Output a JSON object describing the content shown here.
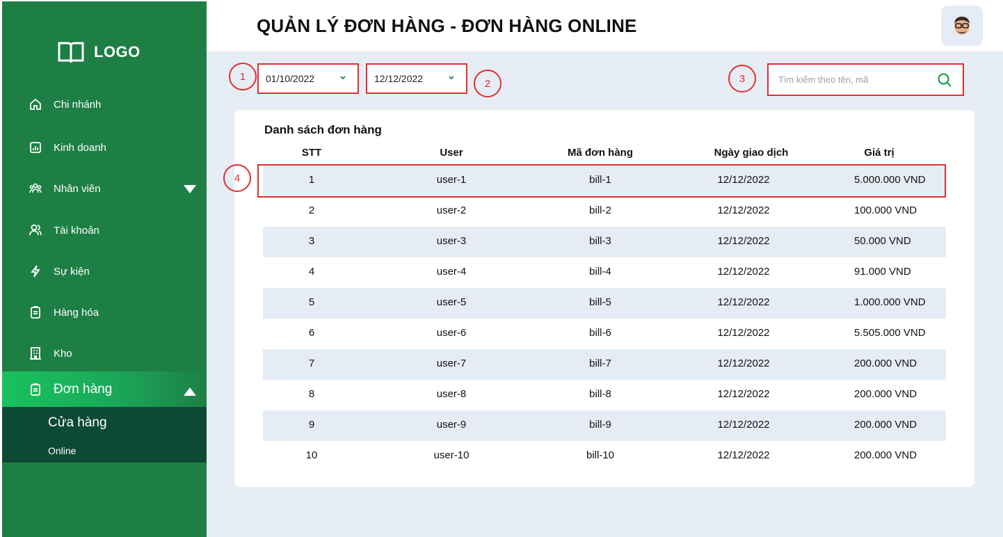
{
  "sidebar": {
    "logo_text": "LOGO",
    "items": [
      {
        "label": "Chi nhánh",
        "icon": "home-icon"
      },
      {
        "label": "Kinh doanh",
        "icon": "chart-icon"
      },
      {
        "label": "Nhân viên",
        "icon": "users-icon"
      },
      {
        "label": "Tài khoản",
        "icon": "account-icon"
      },
      {
        "label": "Sự kiện",
        "icon": "lightning-icon"
      },
      {
        "label": "Hàng hóa",
        "icon": "clipboard-icon"
      },
      {
        "label": "Kho",
        "icon": "building-icon"
      },
      {
        "label": "Đơn hàng",
        "icon": "order-icon"
      }
    ],
    "submenu": [
      "Cửa hàng",
      "Online"
    ]
  },
  "header": {
    "title": "QUẢN LÝ ĐƠN HÀNG - ĐƠN HÀNG ONLINE"
  },
  "filters": {
    "from_date": "01/10/2022",
    "to_date": "12/12/2022",
    "search_placeholder": "Tìm kiếm theo tên, mã"
  },
  "annotations": [
    "1",
    "2",
    "3",
    "4"
  ],
  "orders": {
    "title": "Danh sách đơn hàng",
    "columns": [
      "STT",
      "User",
      "Mã đơn hàng",
      "Ngày giao dịch",
      "Giá trị"
    ],
    "rows": [
      [
        "1",
        "user-1",
        "bill-1",
        "12/12/2022",
        "5.000.000 VND"
      ],
      [
        "2",
        "user-2",
        "bill-2",
        "12/12/2022",
        "100.000 VND"
      ],
      [
        "3",
        "user-3",
        "bill-3",
        "12/12/2022",
        "50.000 VND"
      ],
      [
        "4",
        "user-4",
        "bill-4",
        "12/12/2022",
        "91.000 VND"
      ],
      [
        "5",
        "user-5",
        "bill-5",
        "12/12/2022",
        "1.000.000 VND"
      ],
      [
        "6",
        "user-6",
        "bill-6",
        "12/12/2022",
        "5.505.000 VND"
      ],
      [
        "7",
        "user-7",
        "bill-7",
        "12/12/2022",
        "200.000 VND"
      ],
      [
        "8",
        "user-8",
        "bill-8",
        "12/12/2022",
        "200.000 VND"
      ],
      [
        "9",
        "user-9",
        "bill-9",
        "12/12/2022",
        "200.000 VND"
      ],
      [
        "10",
        "user-10",
        "bill-10",
        "12/12/2022",
        "200.000 VND"
      ]
    ]
  },
  "colors": {
    "sidebar_bg": "#1e7f45",
    "submenu_bg": "#0c4a33",
    "accent_green": "#19c25d",
    "annotation_red": "#e02f2f",
    "main_bg": "#e7edf5"
  }
}
